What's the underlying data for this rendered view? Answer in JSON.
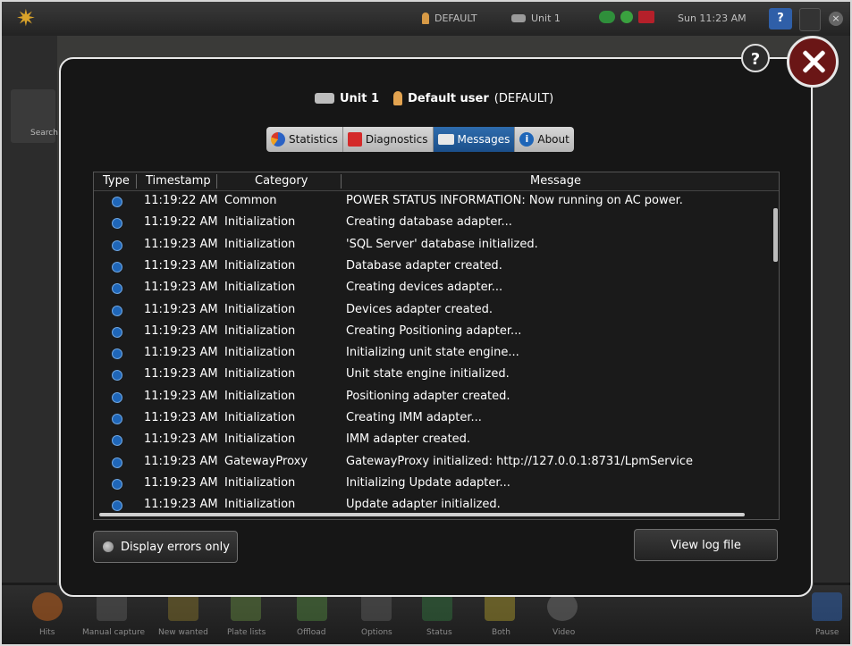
{
  "topbar": {
    "user_label": "DEFAULT",
    "unit_label": "Unit 1",
    "datetime": "Sun 11:23 AM",
    "help_label": "?"
  },
  "background": {
    "search_label": "Search",
    "bottom_items": [
      "Hits",
      "Manual capture",
      "New wanted",
      "Plate lists",
      "Offload",
      "Options",
      "Status",
      "Both",
      "Video",
      "Pause"
    ]
  },
  "dialog": {
    "help_label": "?",
    "unit_name": "Unit 1",
    "user_name": "Default user",
    "user_id": "(DEFAULT)",
    "tabs": [
      {
        "label": "Statistics",
        "icon": "pie-chart-icon",
        "active": false
      },
      {
        "label": "Diagnostics",
        "icon": "medical-cross-icon",
        "active": false
      },
      {
        "label": "Messages",
        "icon": "envelope-icon",
        "active": true
      },
      {
        "label": "About",
        "icon": "info-icon",
        "active": false
      }
    ],
    "table": {
      "headers": [
        "Type",
        "Timestamp",
        "Category",
        "Message"
      ],
      "rows": [
        {
          "type": "info-icon",
          "timestamp": "11:19:22 AM",
          "category": "Common",
          "message": "POWER STATUS INFORMATION: Now running on AC power."
        },
        {
          "type": "info-icon",
          "timestamp": "11:19:22 AM",
          "category": "Initialization",
          "message": "Creating database adapter..."
        },
        {
          "type": "info-icon",
          "timestamp": "11:19:23 AM",
          "category": "Initialization",
          "message": "'SQL Server' database initialized."
        },
        {
          "type": "info-icon",
          "timestamp": "11:19:23 AM",
          "category": "Initialization",
          "message": "Database adapter created."
        },
        {
          "type": "info-icon",
          "timestamp": "11:19:23 AM",
          "category": "Initialization",
          "message": "Creating devices adapter..."
        },
        {
          "type": "info-icon",
          "timestamp": "11:19:23 AM",
          "category": "Initialization",
          "message": "Devices adapter created."
        },
        {
          "type": "info-icon",
          "timestamp": "11:19:23 AM",
          "category": "Initialization",
          "message": "Creating Positioning adapter..."
        },
        {
          "type": "info-icon",
          "timestamp": "11:19:23 AM",
          "category": "Initialization",
          "message": "Initializing unit state engine..."
        },
        {
          "type": "info-icon",
          "timestamp": "11:19:23 AM",
          "category": "Initialization",
          "message": "Unit state engine initialized."
        },
        {
          "type": "info-icon",
          "timestamp": "11:19:23 AM",
          "category": "Initialization",
          "message": "Positioning adapter created."
        },
        {
          "type": "info-icon",
          "timestamp": "11:19:23 AM",
          "category": "Initialization",
          "message": "Creating IMM adapter..."
        },
        {
          "type": "info-icon",
          "timestamp": "11:19:23 AM",
          "category": "Initialization",
          "message": "IMM adapter created."
        },
        {
          "type": "info-icon",
          "timestamp": "11:19:23 AM",
          "category": "GatewayProxy",
          "message": "GatewayProxy initialized: http://127.0.0.1:8731/LpmService"
        },
        {
          "type": "info-icon",
          "timestamp": "11:19:23 AM",
          "category": "Initialization",
          "message": "Initializing Update adapter..."
        },
        {
          "type": "info-icon",
          "timestamp": "11:19:23 AM",
          "category": "Initialization",
          "message": "Update adapter initialized."
        }
      ]
    },
    "display_errors_label": "Display errors only",
    "view_log_label": "View log file"
  },
  "colors": {
    "active_tab": "#1b4f8a",
    "close_button": "#6a1616",
    "info_icon": "#1f66b8"
  }
}
